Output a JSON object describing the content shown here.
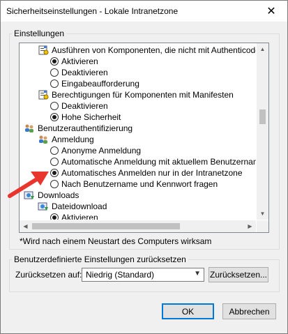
{
  "window": {
    "title": "Sicherheitseinstellungen - Lokale Intranetzone",
    "close_label": "✕"
  },
  "settings_group": {
    "label": "Einstellungen",
    "tree": [
      {
        "type": "category",
        "label": "Ausführen von Komponenten, die nicht mit Authenticode sign",
        "icon": "settings-page-icon"
      },
      {
        "type": "radio",
        "label": "Aktivieren",
        "checked": true
      },
      {
        "type": "radio",
        "label": "Deaktivieren",
        "checked": false
      },
      {
        "type": "radio",
        "label": "Eingabeaufforderung",
        "checked": false
      },
      {
        "type": "category",
        "label": "Berechtigungen für Komponenten mit Manifesten",
        "icon": "settings-page-icon"
      },
      {
        "type": "radio",
        "label": "Deaktivieren",
        "checked": false
      },
      {
        "type": "radio",
        "label": "Hohe Sicherheit",
        "checked": true
      },
      {
        "type": "category",
        "label": "Benutzerauthentifizierung",
        "icon": "users-icon"
      },
      {
        "type": "category",
        "label": "Anmeldung",
        "icon": "users-icon"
      },
      {
        "type": "radio",
        "label": "Anonyme Anmeldung",
        "checked": false
      },
      {
        "type": "radio",
        "label": "Automatische Anmeldung mit aktuellem Benutzernamen u",
        "checked": false
      },
      {
        "type": "radio",
        "label": "Automatisches Anmelden nur in der Intranetzone",
        "checked": true
      },
      {
        "type": "radio",
        "label": "Nach Benutzername und Kennwort fragen",
        "checked": false
      },
      {
        "type": "category",
        "label": "Downloads",
        "icon": "downloads-icon"
      },
      {
        "type": "category",
        "label": "Dateidownload",
        "icon": "downloads-icon"
      },
      {
        "type": "radio",
        "label": "Aktivieren",
        "checked": true
      }
    ],
    "note": "*Wird nach einem Neustart des Computers wirksam"
  },
  "reset_group": {
    "label": "Benutzerdefinierte Einstellungen zurücksetzen",
    "reset_to_label": "Zurücksetzen auf:",
    "level_value": "Niedrig (Standard)",
    "reset_button": "Zurücksetzen..."
  },
  "footer": {
    "ok": "OK",
    "cancel": "Abbrechen"
  },
  "colors": {
    "annotation_arrow": "#e8362e",
    "default_button_border": "#0078d7"
  }
}
